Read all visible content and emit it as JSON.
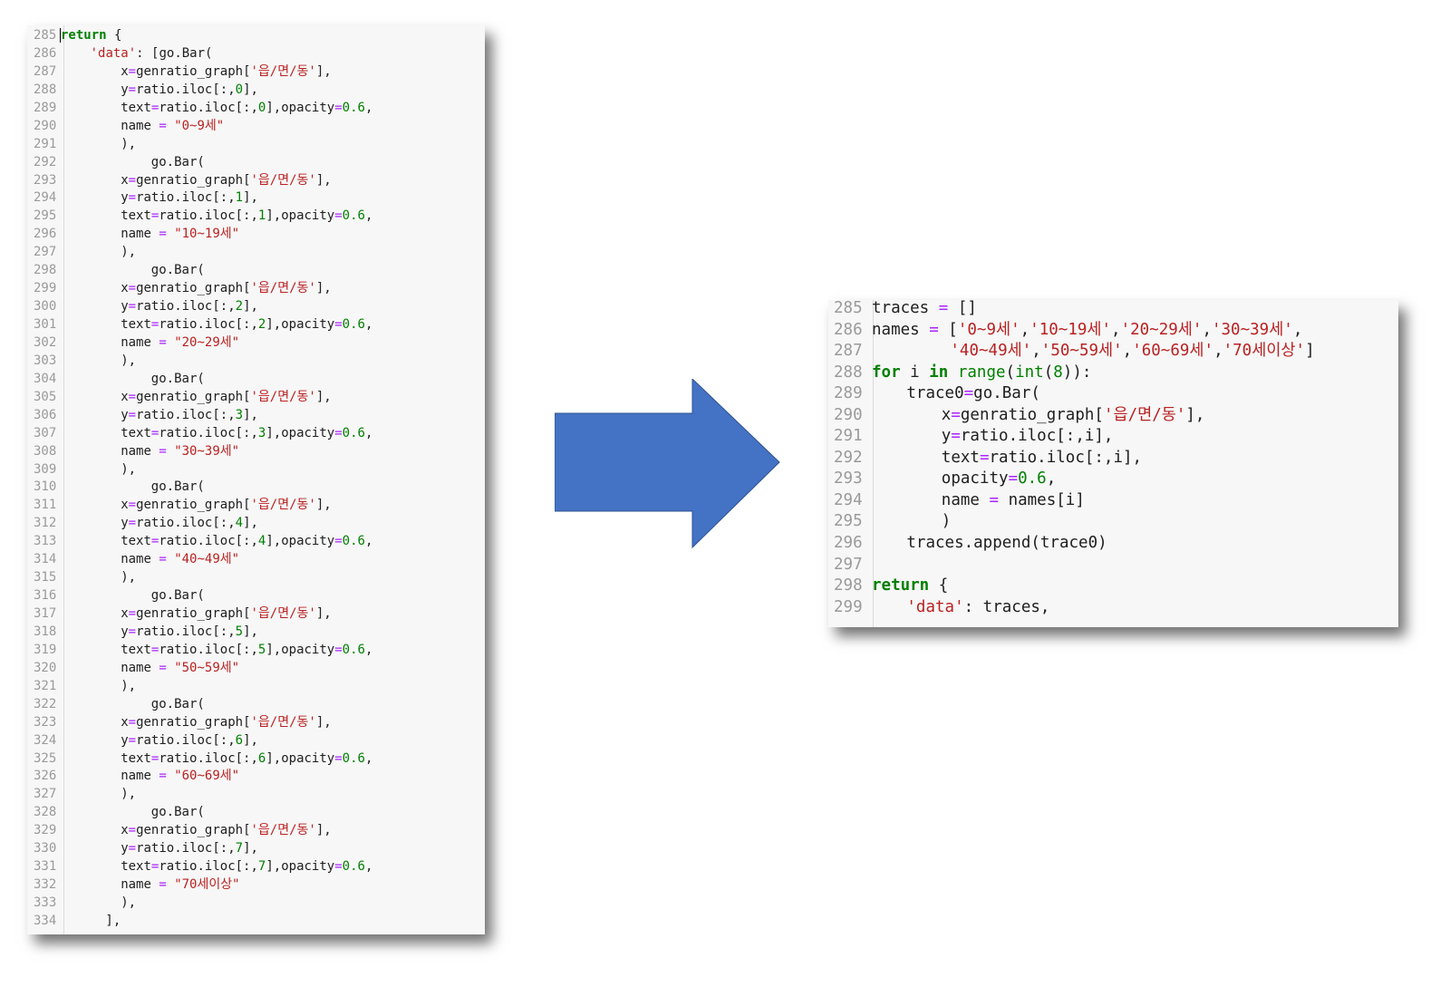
{
  "left_editor": {
    "line_numbers": [
      "285",
      "286",
      "287",
      "288",
      "289",
      "290",
      "291",
      "292",
      "293",
      "294",
      "295",
      "296",
      "297",
      "298",
      "299",
      "300",
      "301",
      "302",
      "303",
      "304",
      "305",
      "306",
      "307",
      "308",
      "309",
      "310",
      "311",
      "312",
      "313",
      "314",
      "315",
      "316",
      "317",
      "318",
      "319",
      "320",
      "321",
      "322",
      "323",
      "324",
      "325",
      "326",
      "327",
      "328",
      "329",
      "330",
      "331",
      "332",
      "333",
      "334"
    ],
    "col_values": [
      "0",
      "1",
      "2",
      "3",
      "4",
      "5",
      "6",
      "7"
    ],
    "bar_names": [
      "\"0~9세\"",
      "\"10~19세\"",
      "\"20~29세\"",
      "\"30~39세\"",
      "\"40~49세\"",
      "\"50~59세\"",
      "\"60~69세\"",
      "\"70세이상\""
    ],
    "tokens": {
      "return_kw": "return",
      "open_brace": " {",
      "data_key": "'data'",
      "data_rest": ": [go.Bar(",
      "go_bar": "go.Bar(",
      "x_prefix": "x",
      "eq": "=",
      "x_value": "genratio_graph[",
      "col_str": "'읍/면/동'",
      "x_close": "],",
      "y_prefix": "y",
      "ratio_iloc": "ratio.iloc[:,",
      "row_close": "],",
      "text_prefix": "text",
      "opacity_label": "],opacity",
      "opacity_value": "0.6",
      "comma": ",",
      "name_label": "name",
      "name_eq": " = ",
      "close_paren": "),",
      "list_close": "],"
    }
  },
  "right_editor": {
    "line_numbers": [
      "285",
      "286",
      "287",
      "288",
      "289",
      "290",
      "291",
      "292",
      "293",
      "294",
      "295",
      "296",
      "297",
      "298",
      "299"
    ],
    "tokens": {
      "traces": "traces",
      "assign": " = ",
      "empty_list": "[]",
      "names": "names",
      "names_open": "[",
      "names_close": "]",
      "name_items_1": [
        "'0~9세'",
        "'10~19세'",
        "'20~29세'",
        "'30~39세'"
      ],
      "name_items_2": [
        "'40~49세'",
        "'50~59세'",
        "'60~69세'",
        "'70세이상'"
      ],
      "for_kw": "for",
      "i_var": " i ",
      "in_kw": "in",
      "range_fn": "range",
      "int_fn": "int",
      "eight": "8",
      "trace0": "trace0",
      "eq": "=",
      "go_bar": "go.Bar(",
      "x": "x",
      "x_value": "genratio_graph[",
      "col_str": "'읍/면/동'",
      "x_close": "],",
      "y": "y",
      "y_value": "ratio.iloc[:,i],",
      "text": "text",
      "text_value": "ratio.iloc[:,i],",
      "opacity": "opacity",
      "opacity_value": "0.6",
      "comma": ",",
      "name": "name",
      "name_assign": " = ",
      "names_i": "names[i]",
      "close": ")",
      "append": "traces.append(trace0)",
      "return_kw": "return",
      "open_brace": " {",
      "data_key": "'data'",
      "data_rest": ": traces,"
    }
  },
  "arrow_color": "#4472c4"
}
